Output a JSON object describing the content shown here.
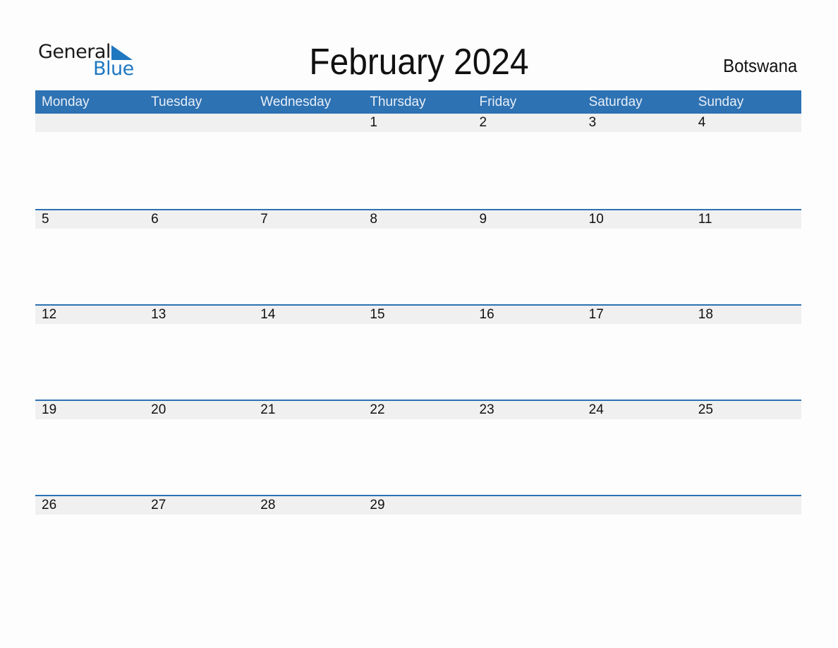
{
  "logo": {
    "line1": "General",
    "line2": "Blue"
  },
  "title": "February 2024",
  "country": "Botswana",
  "colors": {
    "header_bg": "#2d72b3",
    "date_strip_bg": "#f0f0f0",
    "logo_blue": "#1f77c0"
  },
  "weekdays": [
    "Monday",
    "Tuesday",
    "Wednesday",
    "Thursday",
    "Friday",
    "Saturday",
    "Sunday"
  ],
  "weeks": [
    [
      "",
      "",
      "",
      "1",
      "2",
      "3",
      "4"
    ],
    [
      "5",
      "6",
      "7",
      "8",
      "9",
      "10",
      "11"
    ],
    [
      "12",
      "13",
      "14",
      "15",
      "16",
      "17",
      "18"
    ],
    [
      "19",
      "20",
      "21",
      "22",
      "23",
      "24",
      "25"
    ],
    [
      "26",
      "27",
      "28",
      "29",
      "",
      "",
      ""
    ]
  ]
}
